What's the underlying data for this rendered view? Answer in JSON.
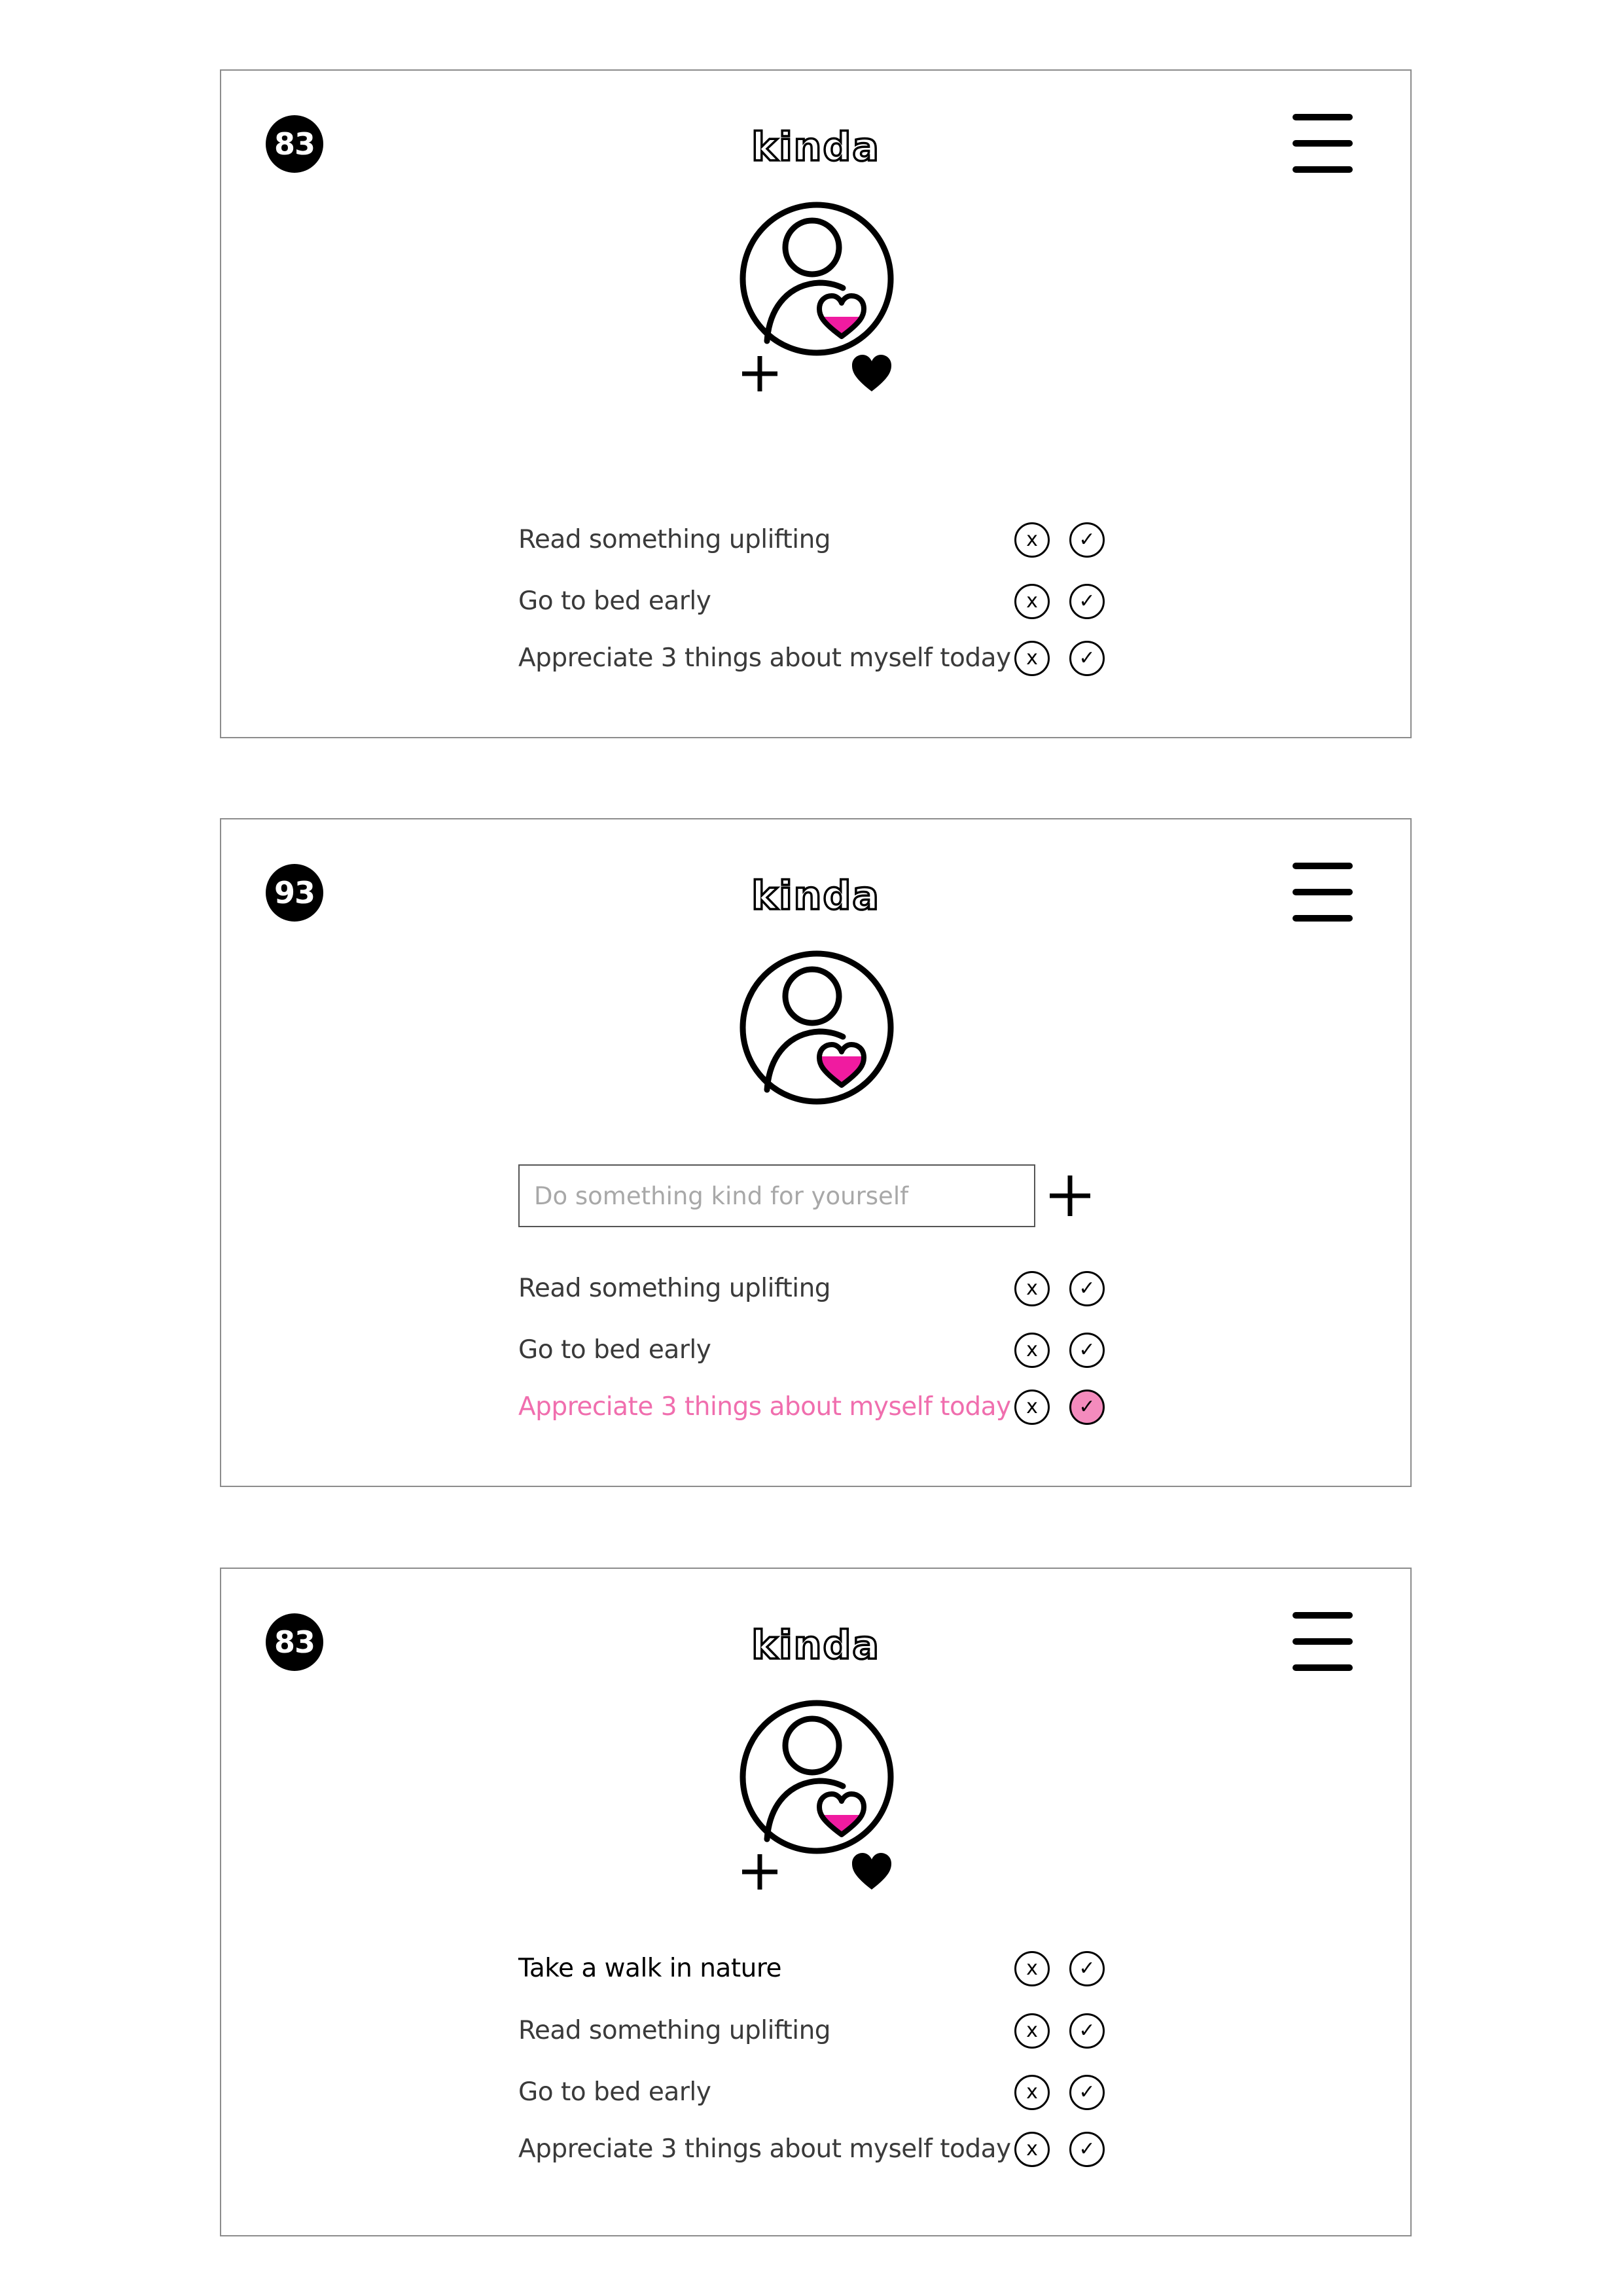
{
  "app": {
    "logo_text": "kinda",
    "accent_color": "#f06eae",
    "check_fill_color": "#f48bbd",
    "x_symbol": "x",
    "check_symbol": "✓"
  },
  "screens": [
    {
      "score": "83",
      "tasks": [
        {
          "label": "Read something uplifting",
          "done": false
        },
        {
          "label": "Go to bed early",
          "done": false
        },
        {
          "label": "Appreciate 3 things about myself today",
          "done": false
        }
      ]
    },
    {
      "score": "93",
      "input": {
        "value": "",
        "placeholder": "Do something kind for yourself"
      },
      "tasks": [
        {
          "label": "Read something uplifting",
          "done": false
        },
        {
          "label": "Go to bed early",
          "done": false
        },
        {
          "label": "Appreciate 3 things about myself today",
          "done": true
        }
      ]
    },
    {
      "score": "83",
      "tasks": [
        {
          "label": "Take a walk in nature",
          "done": false
        },
        {
          "label": "Read something uplifting",
          "done": false
        },
        {
          "label": "Go to bed early",
          "done": false
        },
        {
          "label": "Appreciate 3 things about myself today",
          "done": false
        }
      ]
    }
  ],
  "icons": {
    "score_badge": "score-badge",
    "menu": "hamburger-menu-icon",
    "avatar": "user-heart-icon",
    "add": "plus-icon",
    "favorite": "heart-icon",
    "dismiss": "x-circle-icon",
    "complete": "check-circle-icon"
  }
}
